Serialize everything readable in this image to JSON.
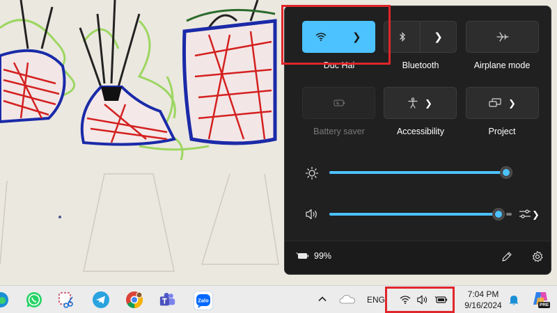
{
  "quick_settings": {
    "tiles": [
      {
        "id": "wifi",
        "label": "Duc Hai",
        "state": "on",
        "icon": "wifi-icon"
      },
      {
        "id": "bluetooth",
        "label": "Bluetooth",
        "state": "off",
        "icon": "bluetooth-icon"
      },
      {
        "id": "airplane",
        "label": "Airplane mode",
        "state": "off",
        "icon": "airplane-icon"
      },
      {
        "id": "battery_saver",
        "label": "Battery saver",
        "state": "disabled",
        "icon": "battery-saver-icon"
      },
      {
        "id": "accessibility",
        "label": "Accessibility",
        "state": "off",
        "icon": "accessibility-icon"
      },
      {
        "id": "project",
        "label": "Project",
        "state": "off",
        "icon": "project-icon"
      }
    ],
    "brightness": {
      "level_percent": 100,
      "icon": "brightness-icon"
    },
    "volume": {
      "level_percent": 100,
      "icon": "speaker-icon"
    },
    "footer": {
      "battery_text": "99%",
      "edit_icon": "pencil-icon",
      "settings_icon": "gear-icon"
    }
  },
  "taskbar": {
    "apps": [
      "edge-icon",
      "whatsapp-icon",
      "snipping-tool-icon",
      "telegram-icon",
      "chrome-icon",
      "teams-icon",
      "zalo-icon"
    ],
    "zalo_label": "Zalo",
    "tray": {
      "language": "ENG",
      "time": "7:04 PM",
      "date": "9/16/2024",
      "copilot_badge": "PRE"
    }
  },
  "colors": {
    "accent": "#4cc2ff",
    "flyout_bg": "#202020",
    "highlight_box": "#e0262a",
    "taskbar_bg": "#ececec"
  }
}
